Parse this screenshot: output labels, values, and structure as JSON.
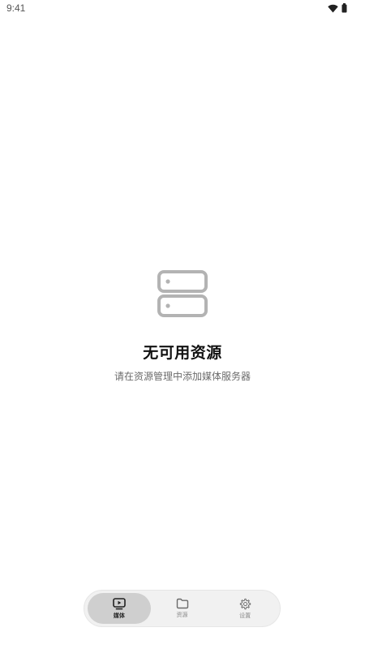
{
  "status_bar": {
    "time": "9:41",
    "icons": [
      "wifi-icon",
      "battery-icon"
    ]
  },
  "empty_state": {
    "icon": "server-icon",
    "title": "无可用资源",
    "subtitle": "请在资源管理中添加媒体服务器"
  },
  "bottom_nav": {
    "items": [
      {
        "label": "媒体",
        "icon": "tv-play-icon",
        "active": true
      },
      {
        "label": "资源",
        "icon": "folder-icon",
        "active": false
      },
      {
        "label": "设置",
        "icon": "gear-icon",
        "active": false
      }
    ]
  },
  "colors": {
    "icon_gray": "#b3b3b3",
    "nav_bg": "#f1f1f1",
    "nav_active_bg": "#cfcfcf"
  }
}
